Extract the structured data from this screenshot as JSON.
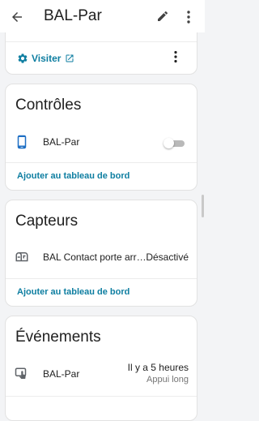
{
  "appbar": {
    "title": "BAL-Par"
  },
  "top_card": {
    "visit_label": "Visiter"
  },
  "controls": {
    "title": "Contrôles",
    "items": [
      {
        "name": "BAL-Par",
        "toggle_on": false
      }
    ],
    "add_label": "Ajouter au tableau de bord"
  },
  "sensors": {
    "title": "Capteurs",
    "items": [
      {
        "name": "BAL Contact porte arr…",
        "state": "Désactivé"
      }
    ],
    "add_label": "Ajouter au tableau de bord"
  },
  "events": {
    "title": "Événements",
    "items": [
      {
        "name": "BAL-Par",
        "time": "Il y a 5 heures",
        "state": "Appui long"
      }
    ]
  },
  "colors": {
    "accent": "#0e7ea1",
    "device_icon": "#1e6fc4",
    "icon_grey": "#5f6368"
  }
}
